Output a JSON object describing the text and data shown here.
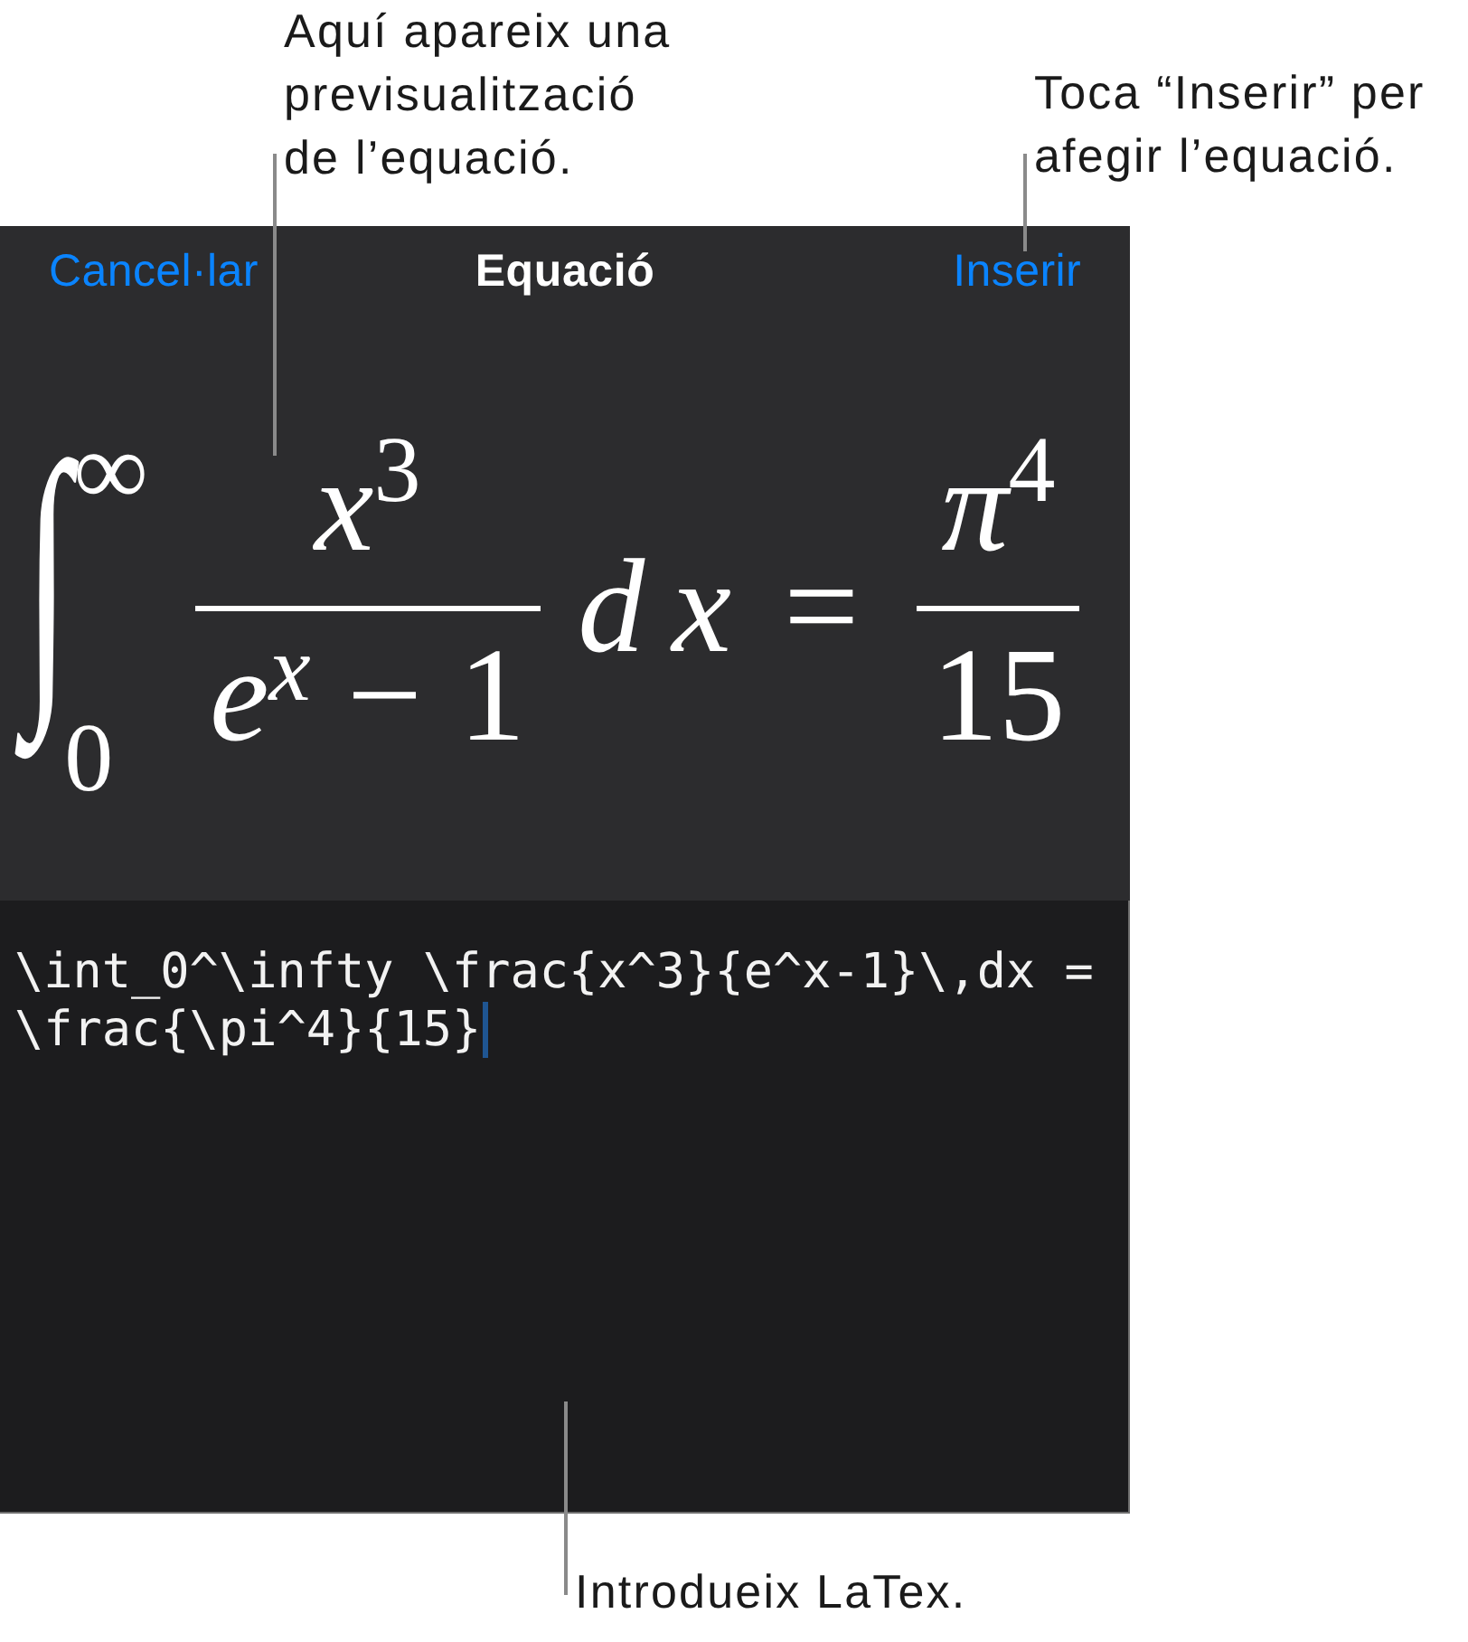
{
  "callouts_top": [
    {
      "kind": "preview",
      "text": "Aquí apareix una previsualització de l’equació."
    },
    {
      "kind": "insert",
      "text": "Toca “Inserir” per afegir l’equació."
    }
  ],
  "dialog": {
    "cancel_button": "Cancel·lar",
    "title": "Equació",
    "insert_button": "Inserir",
    "preview": {
      "equation": [
        {
          "kind": "integral",
          "sign": "∫",
          "lower": "0",
          "upper": "∞"
        },
        {
          "kind": "fraction",
          "numerator": [
            {
              "kind": "power",
              "base": {
                "kind": "variable",
                "text": "x"
              },
              "exponent": {
                "kind": "number",
                "text": "3"
              }
            }
          ],
          "denominator": [
            {
              "kind": "power",
              "base": {
                "kind": "variable",
                "text": "e"
              },
              "exponent": {
                "kind": "variable",
                "text": "x"
              }
            },
            {
              "kind": "operator",
              "text": "−"
            },
            {
              "kind": "number",
              "text": "1"
            }
          ]
        },
        {
          "kind": "variable",
          "text": "d"
        },
        {
          "kind": "variable",
          "text": "x"
        },
        {
          "kind": "operator",
          "text": "="
        },
        {
          "kind": "fraction",
          "numerator": [
            {
              "kind": "power",
              "base": {
                "kind": "variable",
                "text": "π"
              },
              "exponent": {
                "kind": "number",
                "text": "4"
              }
            }
          ],
          "denominator": [
            {
              "kind": "number",
              "text": "15"
            }
          ]
        }
      ]
    },
    "editor": {
      "value": "\\int_0^\\infty \\frac{x^3}{e^x-1}\\,dx = \\frac{\\pi^4}{15}",
      "focused": true
    }
  },
  "callouts_bottom": [
    {
      "kind": "editor",
      "text": "Introdueix LaTex."
    }
  ]
}
